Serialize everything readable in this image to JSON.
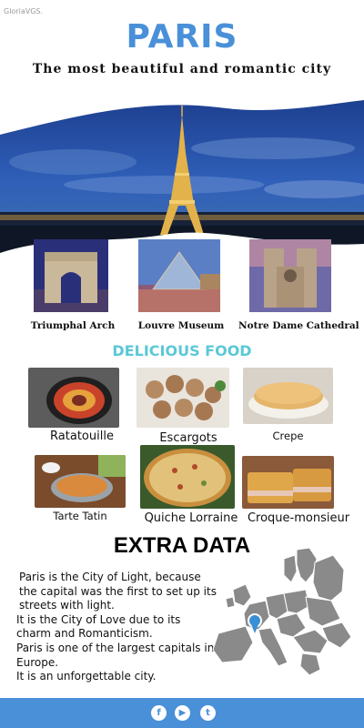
{
  "watermark": "GloriaVGS.",
  "header": {
    "title": "PARIS",
    "subtitle": "The most beautiful and romantic city"
  },
  "landmarks": [
    {
      "label": "Triumphal Arch"
    },
    {
      "label": "Louvre Museum"
    },
    {
      "label": "Notre Dame Cathedral"
    }
  ],
  "food": {
    "heading": "DELICIOUS FOOD",
    "items": [
      {
        "label": "Ratatouille"
      },
      {
        "label": "Escargots"
      },
      {
        "label": "Crepe"
      },
      {
        "label": "Tarte Tatin"
      },
      {
        "label": "Quiche Lorraine"
      },
      {
        "label": "Croque-monsieur"
      }
    ]
  },
  "extra": {
    "heading": "EXTRA DATA",
    "lines": [
      "Paris is the City of Light, because the capital was the first to set up its streets with light.",
      "It is the City of Love due to its charm and Romanticism.",
      "Paris is one of the largest capitals in Europe.",
      "It is an unforgettable city."
    ]
  },
  "footer": {
    "icons": [
      "facebook-icon",
      "youtube-icon",
      "twitter-icon"
    ]
  },
  "colors": {
    "accent_blue": "#4a90d9",
    "food_heading": "#5bc8d6",
    "map_pin": "#3b8fd6"
  }
}
